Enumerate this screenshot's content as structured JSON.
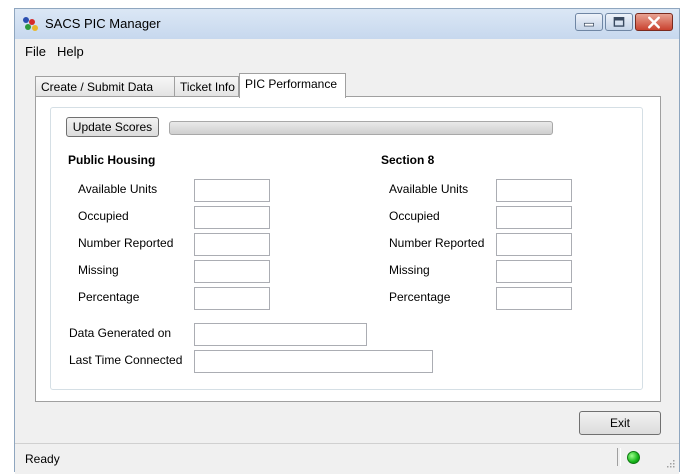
{
  "window": {
    "title": "SACS PIC Manager",
    "icon": "sacs-app-icon",
    "controls": [
      "minimize-icon",
      "maximize-icon",
      "close-icon"
    ],
    "close_color": "#c9422f"
  },
  "menu": {
    "items": [
      {
        "label": "File"
      },
      {
        "label": "Help"
      }
    ]
  },
  "tabs": [
    {
      "label": "Create / Submit Data",
      "active": false
    },
    {
      "label": "Ticket Info",
      "active": false
    },
    {
      "label": "PIC Performance",
      "active": true
    }
  ],
  "performance": {
    "update_button_label": "Update Scores",
    "progress": 0,
    "public_housing": {
      "heading": "Public Housing",
      "fields": [
        {
          "label": "Available Units",
          "value": ""
        },
        {
          "label": "Occupied",
          "value": ""
        },
        {
          "label": "Number Reported",
          "value": ""
        },
        {
          "label": "Missing",
          "value": ""
        },
        {
          "label": "Percentage",
          "value": ""
        }
      ]
    },
    "section8": {
      "heading": "Section 8",
      "fields": [
        {
          "label": "Available Units",
          "value": ""
        },
        {
          "label": "Occupied",
          "value": ""
        },
        {
          "label": "Number Reported",
          "value": ""
        },
        {
          "label": "Missing",
          "value": ""
        },
        {
          "label": "Percentage",
          "value": ""
        }
      ]
    },
    "data_generated": {
      "label": "Data Generated on",
      "value": ""
    },
    "last_connected": {
      "label": "Last Time Connected",
      "value": ""
    }
  },
  "exit_button_label": "Exit",
  "status": {
    "text": "Ready",
    "indicator_icon": "connection-status-led-icon",
    "indicator_color": "#16b51a"
  }
}
